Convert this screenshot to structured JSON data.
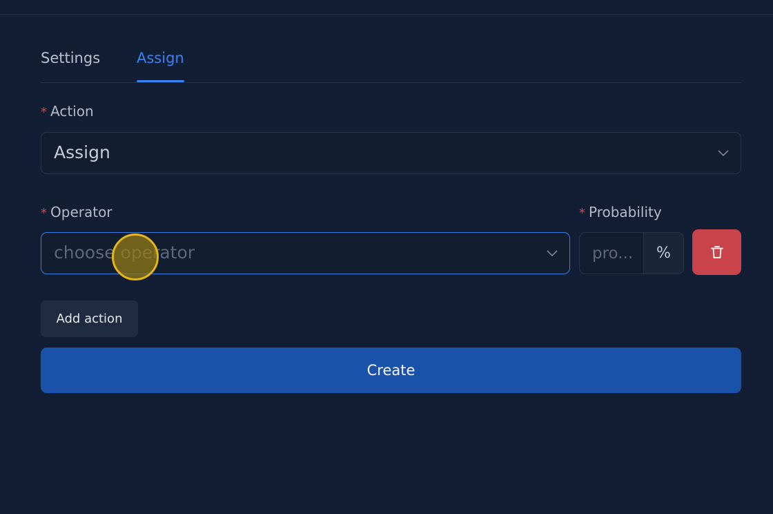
{
  "tabs": [
    {
      "label": "Settings",
      "active": false
    },
    {
      "label": "Assign",
      "active": true
    }
  ],
  "form": {
    "required_marker": "*",
    "action": {
      "label": "Action",
      "value": "Assign",
      "icon": "chevron-down-icon"
    },
    "operator": {
      "label": "Operator",
      "placeholder": "choose operator",
      "icon": "chevron-down-icon"
    },
    "probability": {
      "label": "Probability",
      "placeholder": "pro...",
      "suffix": "%"
    },
    "delete_icon": "trash-icon"
  },
  "buttons": {
    "add_action": "Add action",
    "create": "Create"
  },
  "colors": {
    "background": "#121e33",
    "accent": "#3a82f0",
    "danger": "#c8434a",
    "primary_button": "#1b52a9"
  }
}
